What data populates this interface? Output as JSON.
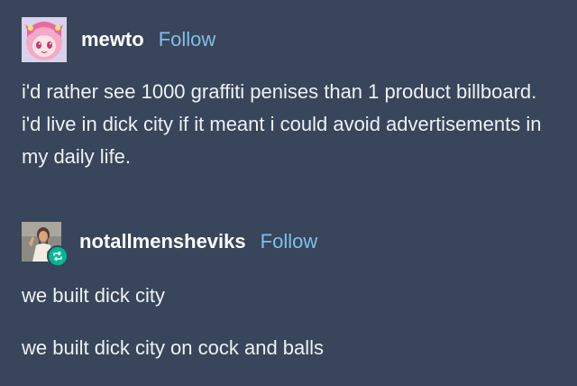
{
  "posts": [
    {
      "username": "mewto",
      "follow_label": "Follow",
      "avatar_icon": "anime-character-avatar-icon",
      "body": "i'd rather see 1000 graffiti penises than 1 product billboard. i'd live in dick city if it meant i could avoid advertisements in my daily life."
    },
    {
      "username": "notallmensheviks",
      "follow_label": "Follow",
      "avatar_icon": "figure-photo-avatar-icon",
      "badge_icon": "reblog-icon",
      "paragraphs": [
        "we built dick city",
        "we built dick city on cock and balls"
      ]
    }
  ],
  "colors": {
    "background": "#38455a",
    "text": "#eef1f5",
    "follow_link": "#7fbfe8",
    "reblog_badge": "#00b894"
  }
}
